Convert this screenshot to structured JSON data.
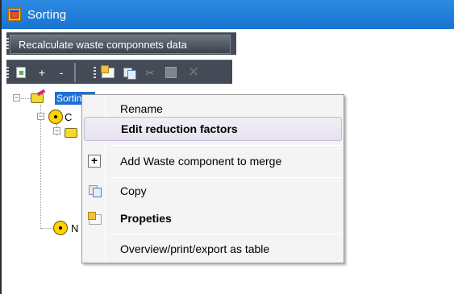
{
  "window": {
    "title": "Sorting"
  },
  "toolbar_top": {
    "recalculate_label": "Recalculate waste componnets data"
  },
  "toolbar_actions": {
    "add_symbol": "+",
    "remove_symbol": "-",
    "cut_symbol": "✂",
    "delete_symbol": "✕"
  },
  "tree": {
    "root_label": "Sorting",
    "child_1_initial": "C",
    "child_2_initial": "N"
  },
  "context_menu": {
    "items": [
      {
        "label": "Rename",
        "icon": "",
        "bold": false
      },
      {
        "label": "Edit reduction factors",
        "icon": "",
        "bold": true
      },
      {
        "label": "Add Waste component to merge",
        "icon": "plus-icon",
        "bold": false
      },
      {
        "label": "Copy",
        "icon": "copy-icon",
        "bold": false
      },
      {
        "label": "Propeties",
        "icon": "properties-icon",
        "bold": true
      },
      {
        "label": "Overview/print/export as table",
        "icon": "",
        "bold": false
      }
    ],
    "plus_glyph": "+"
  },
  "colors": {
    "titlebar": "#1e7ad6",
    "toolbar": "#444b56",
    "selection": "#1e6fd6",
    "menu_highlight": "#e8e4f0"
  }
}
